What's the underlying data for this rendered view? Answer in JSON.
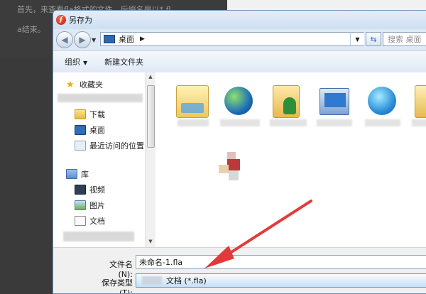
{
  "background": {
    "line1": "首先，来查看fla格式的文件，后缀名是以*.fl",
    "line2": "a结束。"
  },
  "dialog": {
    "title": "另存为",
    "app_icon_letter": "f",
    "address": "桌面",
    "search_placeholder": "搜索 桌面",
    "toolbar": {
      "organize": "组织",
      "new_folder": "新建文件夹"
    },
    "nav": {
      "favorites": "收藏夹",
      "downloads": "下载",
      "desktop": "桌面",
      "recent": "最近访问的位置",
      "libraries": "库",
      "videos": "视频",
      "pictures": "图片",
      "documents": "文档"
    },
    "filename_label": "文件名(N):",
    "filename_value": "未命名-1.fla",
    "filetype_label": "保存类型(T):",
    "filetype_value": "文档 (*.fla)"
  },
  "colors": {
    "annotation_arrow": "#e23a3a",
    "accent": "#2d69b3"
  },
  "icons": {
    "back": "back-arrow-icon",
    "forward": "forward-arrow-icon",
    "refresh": "refresh-icon",
    "search": "search-icon"
  }
}
